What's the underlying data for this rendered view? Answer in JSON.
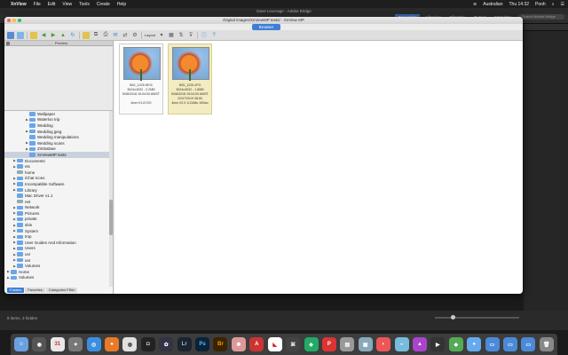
{
  "menubar": {
    "app_name": "XnView",
    "items": [
      "File",
      "Edit",
      "View",
      "Tools",
      "Create",
      "Help"
    ],
    "right": {
      "lang": "Australian",
      "clock": "Thu 14:32",
      "user": "Pooh"
    }
  },
  "bridge": {
    "title": "Dave Leverage - Adobe Bridge",
    "tabs": [
      "Essentials",
      "Libraries",
      "Filmstrip",
      "Output",
      "Metadata"
    ],
    "search_placeholder": "Search Adobe Bridge",
    "status": "8 items, 3 hidden"
  },
  "window": {
    "title": "/Digital images/XnViewMP tests/ - XnView MP",
    "active_tab": "Browser",
    "layout_label": "Layout"
  },
  "left_panel": {
    "header": "Preview",
    "tree": [
      {
        "label": "Wallpaper",
        "indent": 3,
        "arrow": "",
        "gray": false
      },
      {
        "label": "Waterloo trip",
        "indent": 3,
        "arrow": "▶",
        "gray": false
      },
      {
        "label": "Wedding",
        "indent": 3,
        "arrow": "",
        "gray": false
      },
      {
        "label": "Wedding jpeg",
        "indent": 3,
        "arrow": "▶",
        "gray": false
      },
      {
        "label": "Wedding manipulations",
        "indent": 3,
        "arrow": "",
        "gray": false
      },
      {
        "label": "Wedding scans",
        "indent": 3,
        "arrow": "▶",
        "gray": false
      },
      {
        "label": "Zimbabwe",
        "indent": 3,
        "arrow": "▶",
        "gray": false
      },
      {
        "label": "XnViewMP tests",
        "indent": 3,
        "arrow": "",
        "gray": false,
        "selected": true
      },
      {
        "label": "Documents",
        "indent": 1,
        "arrow": "▶",
        "gray": false
      },
      {
        "label": "etc",
        "indent": 1,
        "arrow": "▶",
        "gray": false
      },
      {
        "label": "home",
        "indent": 1,
        "arrow": "",
        "gray": true
      },
      {
        "label": "iChat Icons",
        "indent": 1,
        "arrow": "▶",
        "gray": false
      },
      {
        "label": "Incompatible Software",
        "indent": 1,
        "arrow": "▶",
        "gray": false
      },
      {
        "label": "Library",
        "indent": 1,
        "arrow": "▶",
        "gray": false
      },
      {
        "label": "Mac Driver v1.1",
        "indent": 1,
        "arrow": "",
        "gray": false
      },
      {
        "label": "net",
        "indent": 1,
        "arrow": "",
        "gray": true
      },
      {
        "label": "Network",
        "indent": 1,
        "arrow": "▶",
        "gray": false
      },
      {
        "label": "Pictures",
        "indent": 1,
        "arrow": "▶",
        "gray": false
      },
      {
        "label": "private",
        "indent": 1,
        "arrow": "▶",
        "gray": false
      },
      {
        "label": "sbin",
        "indent": 1,
        "arrow": "▶",
        "gray": false
      },
      {
        "label": "System",
        "indent": 1,
        "arrow": "▶",
        "gray": false
      },
      {
        "label": "tmp",
        "indent": 1,
        "arrow": "▶",
        "gray": false
      },
      {
        "label": "User Guides And Information",
        "indent": 1,
        "arrow": "▶",
        "gray": false
      },
      {
        "label": "Users",
        "indent": 1,
        "arrow": "▶",
        "gray": false
      },
      {
        "label": "usr",
        "indent": 1,
        "arrow": "▶",
        "gray": false
      },
      {
        "label": "var",
        "indent": 1,
        "arrow": "▶",
        "gray": false
      },
      {
        "label": "Volumes",
        "indent": 1,
        "arrow": "▶",
        "gray": false
      },
      {
        "label": "Home",
        "indent": 0,
        "arrow": "▶",
        "gray": false
      },
      {
        "label": "Volumes",
        "indent": 0,
        "arrow": "▶",
        "gray": false
      }
    ],
    "bottom_tabs": [
      "Folders",
      "Favorites",
      "Categories Filter"
    ]
  },
  "thumbs": [
    {
      "name": "IMG_1225.HEIC",
      "line2": "3024x4032 - 2.2MB",
      "line3": "5/08/2018 15:04:00 AWST",
      "line4": "4mm f/1.8 ISO",
      "selected": false
    },
    {
      "name": "IMG_1225.JPG",
      "line2": "3024x4032 - 1.8MB",
      "line3": "5/08/2018 15:04:00 AWST",
      "line4": "22/07/2019 08:50",
      "line5": "4mm f/2.0 1/1348s 100iso",
      "selected": true
    }
  ]
}
